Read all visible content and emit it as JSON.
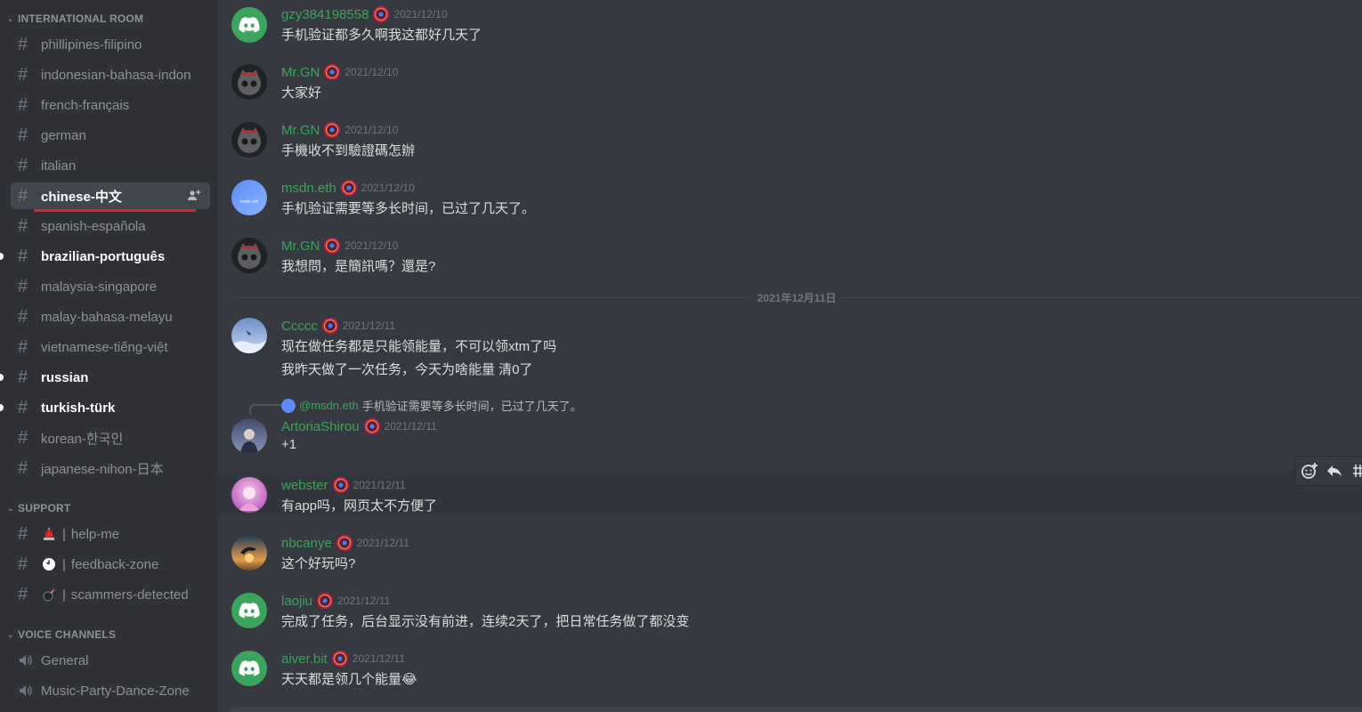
{
  "sidebar": {
    "international_room": {
      "title": "INTERNATIONAL ROOM",
      "channels": [
        {
          "label": "phillipines-filipino"
        },
        {
          "label": "indonesian-bahasa-indon"
        },
        {
          "label": "french-français"
        },
        {
          "label": "german"
        },
        {
          "label": "italian"
        },
        {
          "label": "chinese-中文"
        },
        {
          "label": "spanish-española"
        },
        {
          "label": "brazilian-português"
        },
        {
          "label": "malaysia-singapore"
        },
        {
          "label": "malay-bahasa-melayu"
        },
        {
          "label": "vietnamese-tiếng-việt"
        },
        {
          "label": "russian"
        },
        {
          "label": "turkish-türk"
        },
        {
          "label": "korean-한국인"
        },
        {
          "label": "japanese-nihon-日本"
        }
      ]
    },
    "support": {
      "title": "SUPPORT",
      "channels": [
        {
          "label": "help-me",
          "emoji": "🚨"
        },
        {
          "label": "feedback-zone",
          "emoji": "🕚"
        },
        {
          "label": "scammers-detected",
          "emoji": "💣"
        }
      ]
    },
    "voice": {
      "title": "VOICE CHANNELS",
      "channels": [
        {
          "label": "General"
        },
        {
          "label": "Music-Party-Dance-Zone"
        }
      ]
    },
    "active_channel": "chinese-中文",
    "hash_symbol": "#",
    "pipe": "|"
  },
  "chat": {
    "date_divider": "2021年12月11日",
    "messages": [
      {
        "user": "gzy384198558",
        "time": "2021/12/10",
        "lines": [
          "手机验证都多久啊我这都好几天了"
        ],
        "avatar": "discord-default"
      },
      {
        "user": "Mr.GN",
        "time": "2021/12/10",
        "lines": [
          "大家好"
        ],
        "avatar": "robot-cat"
      },
      {
        "user": "Mr.GN",
        "time": "2021/12/10",
        "lines": [
          "手機收不到驗證碼怎辦"
        ],
        "avatar": "robot-cat"
      },
      {
        "user": "msdn.eth",
        "time": "2021/12/10",
        "lines": [
          "手机验证需要等多长时间，已过了几天了。"
        ],
        "avatar": "gradient-blue",
        "avatar_text": "msdn.eth"
      },
      {
        "user": "Mr.GN",
        "time": "2021/12/10",
        "lines": [
          "我想問，是簡訊嗎？還是?"
        ],
        "avatar": "robot-cat"
      },
      {
        "user": "Ccccc",
        "time": "2021/12/11",
        "lines": [
          "现在做任务都是只能领能量，不可以领xtm了吗",
          "我昨天做了一次任务，今天为啥能量 清0了"
        ],
        "avatar": "sky-scene"
      },
      {
        "user": "ArtoriaShirou",
        "time": "2021/12/11",
        "lines": [
          "+1"
        ],
        "avatar": "night-scene",
        "reply": {
          "mention": "@msdn.eth",
          "text": "手机验证需要等多长时间，已过了几天了。"
        }
      },
      {
        "user": "webster",
        "time": "2021/12/11",
        "lines": [
          "有app吗，网页太不方便了"
        ],
        "avatar": "pink-art"
      },
      {
        "user": "nbcanye",
        "time": "2021/12/11",
        "lines": [
          "这个好玩吗?"
        ],
        "avatar": "sunset-dolphin"
      },
      {
        "user": "laojiu",
        "time": "2021/12/11",
        "lines": [
          "完成了任务，后台显示没有前进，连续2天了，把日常任务做了都没变"
        ],
        "avatar": "discord-default"
      },
      {
        "user": "aiver.bit",
        "time": "2021/12/11",
        "lines": [
          "天天都是领几个能量😂"
        ],
        "avatar": "discord-default"
      }
    ]
  },
  "colors": {
    "sidebar_bg": "#2f3136",
    "chat_bg": "#36393f",
    "username_green": "#3ba55d",
    "underline_red": "#e2212b"
  }
}
